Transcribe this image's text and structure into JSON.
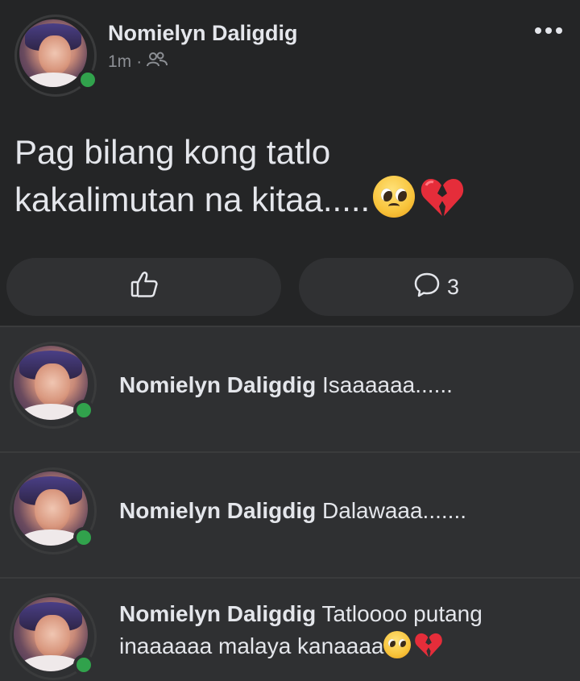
{
  "post": {
    "author": "Nomielyn Daligdig",
    "time": "1m",
    "separator": "·",
    "audience_icon": "friends-icon",
    "text_line1": "Pag bilang kong tatlo",
    "text_line2": "kakalimutan na kitaa.....",
    "comment_count": "3",
    "colors": {
      "background": "#242526",
      "online": "#31a24c",
      "text": "#e4e6eb"
    }
  },
  "comments": [
    {
      "author": "Nomielyn Daligdig",
      "text": "Isaaaaaa......"
    },
    {
      "author": "Nomielyn Daligdig",
      "text": "Dalawaaa......."
    },
    {
      "author": "Nomielyn Daligdig",
      "text": "Tatloooo putang inaaaaaa malaya kanaaaa"
    }
  ]
}
